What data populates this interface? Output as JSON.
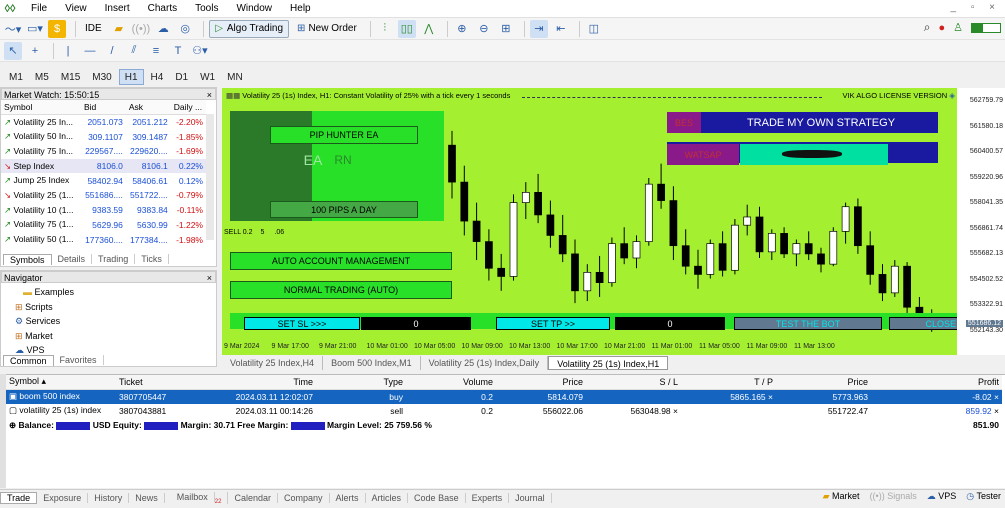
{
  "menu": [
    "File",
    "View",
    "Insert",
    "Charts",
    "Tools",
    "Window",
    "Help"
  ],
  "toolbar": {
    "ide": "IDE",
    "algo": "Algo Trading",
    "new_order": "New Order"
  },
  "timeframes": [
    "M1",
    "M5",
    "M15",
    "M30",
    "H1",
    "H4",
    "D1",
    "W1",
    "MN"
  ],
  "active_timeframe": "H1",
  "market_watch": {
    "title": "Market Watch: 15:50:15",
    "cols": [
      "Symbol",
      "Bid",
      "Ask",
      "Daily ..."
    ],
    "rows": [
      {
        "symbol": "Volatility 25 In...",
        "bid": "2051.073",
        "ask": "2051.212",
        "daily": "-2.20%",
        "dir": "up"
      },
      {
        "symbol": "Volatility 50 In...",
        "bid": "309.1107",
        "ask": "309.1487",
        "daily": "-1.85%",
        "dir": "up"
      },
      {
        "symbol": "Volatility 75 In...",
        "bid": "229567....",
        "ask": "229620....",
        "daily": "-1.69%",
        "dir": "up"
      },
      {
        "symbol": "Step Index",
        "bid": "8106.0",
        "ask": "8106.1",
        "daily": "0.22%",
        "dir": "down"
      },
      {
        "symbol": "Jump 25 Index",
        "bid": "58402.94",
        "ask": "58406.61",
        "daily": "0.12%",
        "dir": "up"
      },
      {
        "symbol": "Volatility 25 (1...",
        "bid": "551686....",
        "ask": "551722....",
        "daily": "-0.79%",
        "dir": "down"
      },
      {
        "symbol": "Volatility 10 (1...",
        "bid": "9383.59",
        "ask": "9383.84",
        "daily": "-0.11%",
        "dir": "up"
      },
      {
        "symbol": "Volatility 75 (1...",
        "bid": "5629.96",
        "ask": "5630.99",
        "daily": "-1.22%",
        "dir": "up"
      },
      {
        "symbol": "Volatility 50 (1...",
        "bid": "177360....",
        "ask": "177384....",
        "daily": "-1.98%",
        "dir": "up"
      }
    ],
    "tabs": [
      "Symbols",
      "Details",
      "Trading",
      "Ticks"
    ]
  },
  "navigator": {
    "title": "Navigator",
    "items": [
      "Examples",
      "Scripts",
      "Services",
      "Market",
      "VPS"
    ],
    "tabs": [
      "Common",
      "Favorites"
    ]
  },
  "chart": {
    "title": "Volatility 25 (1s) Index, H1:  Constant Volatility of 25% with a tick every 1 seconds",
    "license": "VIK ALGO LICENSE VERSION",
    "ea": {
      "pip_hunter": "PIP HUNTER EA",
      "ea_left": "EA",
      "ea_right": "RN",
      "pips": "100 PIPS A DAY",
      "sell": "SELL 0.2",
      "sell_val": "5",
      "sell_tail": ".06",
      "auto_mgmt": "AUTO ACCOUNT MANAGEMENT",
      "normal": "NORMAL TRADING (AUTO)",
      "set_sl": "SET SL >>>",
      "sl_val": "0",
      "set_tp": "SET TP >>",
      "tp_val": "0",
      "test": "TEST THE BOT",
      "close": "CLOSE A",
      "bes": "BES",
      "trade_own": "TRADE MY OWN STRATEGY",
      "watsap": "WATSAP"
    },
    "y_labels": [
      "562759.79",
      "561580.18",
      "560400.57",
      "559220.96",
      "558041.35",
      "556861.74",
      "555682.13",
      "554502.52",
      "553322.91",
      "552143.30",
      "551686.12"
    ],
    "x_labels": [
      "9 Mar 2024",
      "9 Mar 17:00",
      "9 Mar 21:00",
      "10 Mar 01:00",
      "10 Mar 05:00",
      "10 Mar 09:00",
      "10 Mar 13:00",
      "10 Mar 17:00",
      "10 Mar 21:00",
      "11 Mar 01:00",
      "11 Mar 05:00",
      "11 Mar 09:00",
      "11 Mar 13:00"
    ],
    "candles": [
      [
        560600,
        561300,
        558000,
        558800
      ],
      [
        558800,
        559600,
        556200,
        556900
      ],
      [
        556900,
        557800,
        555000,
        555900
      ],
      [
        555900,
        556500,
        554000,
        554600
      ],
      [
        554600,
        555300,
        553500,
        554200
      ],
      [
        554200,
        558200,
        554000,
        557800
      ],
      [
        557800,
        558800,
        557000,
        558300
      ],
      [
        558300,
        559200,
        556800,
        557200
      ],
      [
        557200,
        557900,
        555600,
        556200
      ],
      [
        556200,
        557200,
        554900,
        555300
      ],
      [
        555300,
        556000,
        552900,
        553500
      ],
      [
        553500,
        554800,
        553000,
        554400
      ],
      [
        554400,
        555200,
        553200,
        553900
      ],
      [
        553900,
        556100,
        553700,
        555800
      ],
      [
        555800,
        556600,
        554800,
        555100
      ],
      [
        555100,
        556200,
        554600,
        555900
      ],
      [
        555900,
        559000,
        555700,
        558700
      ],
      [
        558700,
        559700,
        557500,
        557900
      ],
      [
        557900,
        558600,
        555000,
        555700
      ],
      [
        555700,
        556500,
        554300,
        554700
      ],
      [
        554700,
        555500,
        553600,
        554300
      ],
      [
        554300,
        556000,
        554100,
        555800
      ],
      [
        555800,
        556400,
        554200,
        554500
      ],
      [
        554500,
        557000,
        554300,
        556700
      ],
      [
        556700,
        557700,
        556200,
        557100
      ],
      [
        557100,
        557600,
        555100,
        555400
      ],
      [
        555400,
        556500,
        555000,
        556300
      ],
      [
        556300,
        556600,
        555100,
        555300
      ],
      [
        555300,
        556000,
        554700,
        555800
      ],
      [
        555800,
        556400,
        555000,
        555300
      ],
      [
        555300,
        555600,
        554400,
        554800
      ],
      [
        554800,
        556600,
        554700,
        556400
      ],
      [
        556400,
        557800,
        555800,
        557600
      ],
      [
        557600,
        558000,
        555300,
        555700
      ],
      [
        555700,
        556400,
        553800,
        554300
      ],
      [
        554300,
        554800,
        553000,
        553400
      ],
      [
        553400,
        555000,
        553200,
        554700
      ],
      [
        554700,
        554900,
        552300,
        552700
      ],
      [
        552700,
        553200,
        551600,
        551900
      ],
      [
        551900,
        552600,
        551500,
        551686
      ]
    ],
    "tabs": [
      "Volatility 25 Index,H4",
      "Boom 500 Index,M1",
      "Volatility 25 (1s) Index,Daily",
      "Volatility 25 (1s) Index,H1"
    ]
  },
  "trade": {
    "cols": [
      "Symbol",
      "Ticket",
      "Time",
      "Type",
      "Volume",
      "Price",
      "S / L",
      "T / P",
      "Price",
      "Profit"
    ],
    "rows": [
      {
        "symbol": "boom 500 index",
        "ticket": "3807705447",
        "time": "2024.03.11 12:02:07",
        "type": "buy",
        "volume": "0.2",
        "price": "5814.079",
        "sl": "",
        "tp": "5865.165",
        "cur": "5773.963",
        "profit": "-8.02"
      },
      {
        "symbol": "volatility 25 (1s) index",
        "ticket": "3807043881",
        "time": "2024.03.11 00:14:26",
        "type": "sell",
        "volume": "0.2",
        "price": "556022.06",
        "sl": "563048.98",
        "tp": "",
        "cur": "551722.47",
        "profit": "859.92"
      }
    ],
    "balance_label": "Balance:",
    "balance_suffix": "USD",
    "equity_label": "Equity:",
    "margin": "Margin: 30.71",
    "free_margin": "Free Margin:",
    "margin_level": "Margin Level: 25 759.56 %",
    "total": "851.90"
  },
  "bottom_tabs": [
    "Trade",
    "Exposure",
    "History",
    "News",
    "Mailbox",
    "Calendar",
    "Company",
    "Alerts",
    "Articles",
    "Code Base",
    "Experts",
    "Journal"
  ],
  "mailbox_badge": "22",
  "status_right": [
    "Market",
    "Signals",
    "VPS",
    "Tester"
  ],
  "colors": {
    "chart_bg": "#a4f030",
    "bull": "#ffffff",
    "bear": "#000000"
  }
}
